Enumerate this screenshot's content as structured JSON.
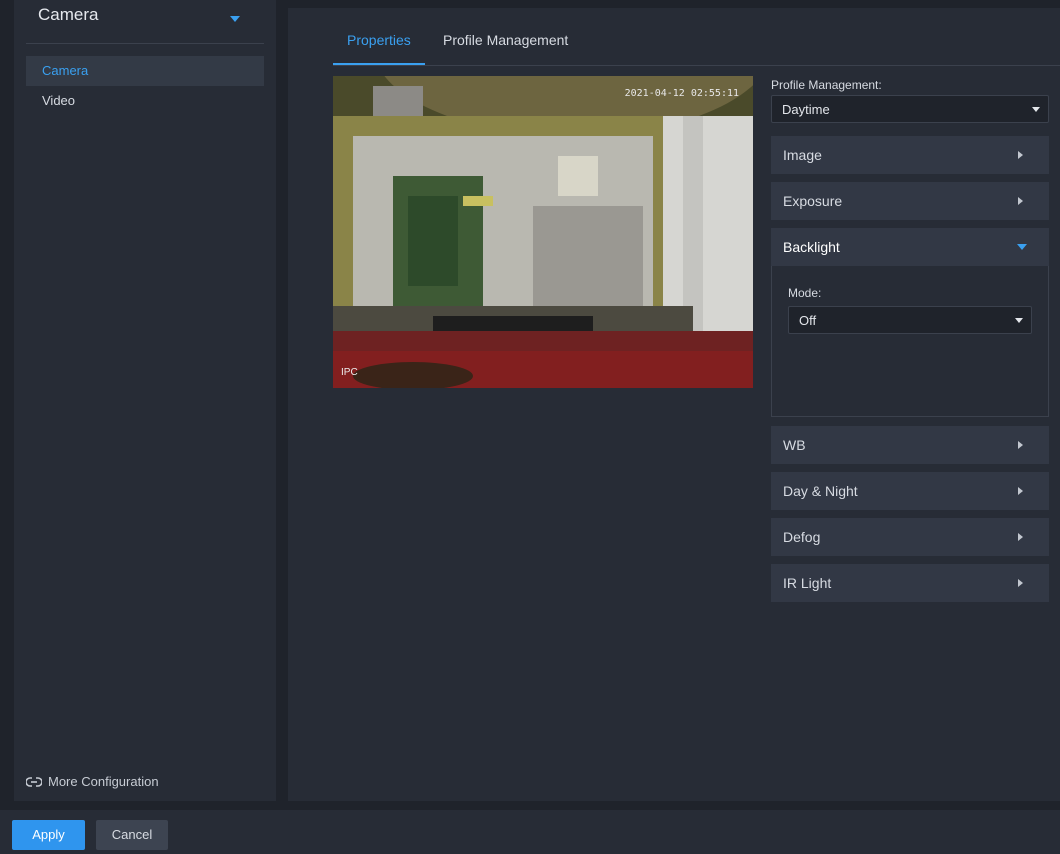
{
  "sidebar": {
    "title": "Camera",
    "items": [
      {
        "label": "Camera",
        "active": true
      },
      {
        "label": "Video",
        "active": false
      }
    ],
    "more_label": "More Configuration"
  },
  "tabs": [
    {
      "label": "Properties",
      "active": true
    },
    {
      "label": "Profile Management",
      "active": false
    }
  ],
  "preview": {
    "timestamp": "2021-04-12 02:55:11",
    "channel_label": "IPC"
  },
  "profile": {
    "label": "Profile Management:",
    "value": "Daytime"
  },
  "sections": [
    {
      "label": "Image",
      "expanded": false
    },
    {
      "label": "Exposure",
      "expanded": false
    },
    {
      "label": "Backlight",
      "expanded": true
    },
    {
      "label": "WB",
      "expanded": false
    },
    {
      "label": "Day & Night",
      "expanded": false
    },
    {
      "label": "Defog",
      "expanded": false
    },
    {
      "label": "IR Light",
      "expanded": false
    }
  ],
  "backlight": {
    "mode_label": "Mode:",
    "mode_value": "Off"
  },
  "footer": {
    "apply": "Apply",
    "cancel": "Cancel"
  },
  "colors": {
    "accent": "#3aa0f0",
    "background": "#1f232b",
    "panel": "#272c36",
    "section": "#323845"
  }
}
